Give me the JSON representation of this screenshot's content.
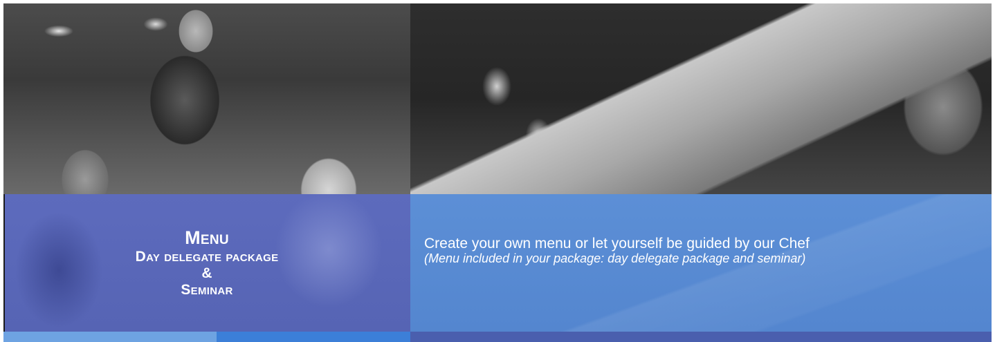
{
  "left_panel": {
    "photo": "waiter-serving-guests-photo",
    "title": "Menu",
    "lines": [
      "Day delegate package",
      "&",
      "Seminar"
    ]
  },
  "right_panel": {
    "photo": "table-setting-photo",
    "lead": "Create your own menu or let yourself be guided by our Chef",
    "note": "(Menu included in your package: day delegate package and seminar)"
  },
  "colors": {
    "left_overlay": "#5d6bbd",
    "right_overlay": "#5c8fd6",
    "bar_left_light": "#6ea3e2",
    "bar_left_dark": "#3c7fd8",
    "bar_right": "#4a5fae"
  }
}
